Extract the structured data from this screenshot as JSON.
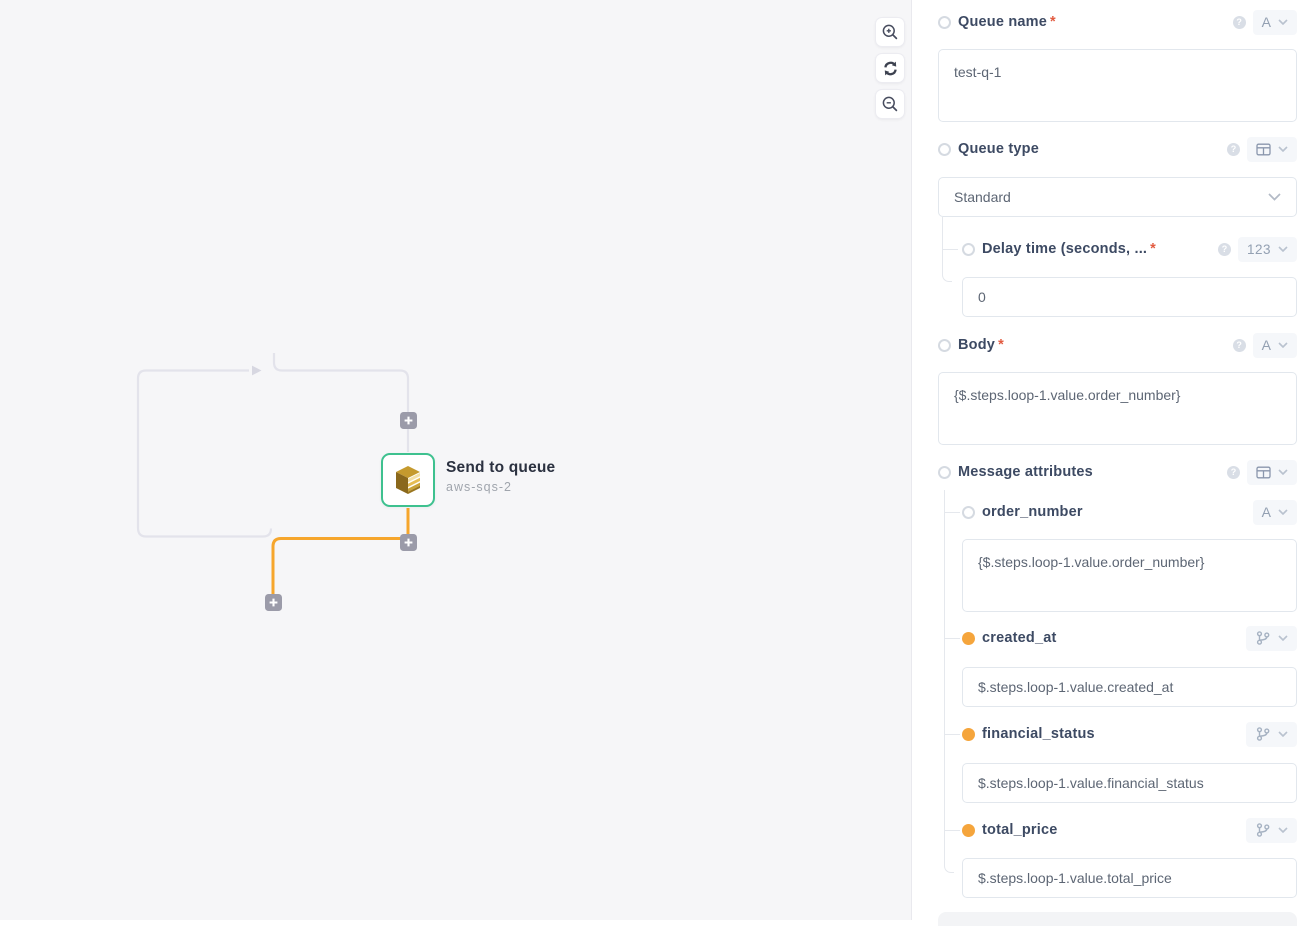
{
  "canvas": {
    "node": {
      "title": "Send to queue",
      "subtitle": "aws-sqs-2"
    },
    "controls": [
      {
        "name": "zoom-in"
      },
      {
        "name": "refresh"
      },
      {
        "name": "zoom-out"
      }
    ]
  },
  "panel": {
    "fields": {
      "queue_name": {
        "label": "Queue name",
        "required_mark": "*",
        "type_badge": "A",
        "value": "test-q-1"
      },
      "queue_type": {
        "label": "Queue type",
        "selected_option": "Standard"
      },
      "delay_time": {
        "label": "Delay time (seconds, ...",
        "required_mark": "*",
        "type_badge": "123",
        "value": "0"
      },
      "body": {
        "label": "Body",
        "required_mark": "*",
        "type_badge": "A",
        "value": "{$.steps.loop-1.value.order_number}"
      },
      "message_attributes": {
        "label": "Message attributes"
      },
      "order_number": {
        "label": "order_number",
        "type_badge": "A",
        "value": "{$.steps.loop-1.value.order_number}"
      },
      "created_at": {
        "label": "created_at",
        "value": "$.steps.loop-1.value.created_at"
      },
      "financial_status": {
        "label": "financial_status",
        "value": "$.steps.loop-1.value.financial_status"
      },
      "total_price": {
        "label": "total_price",
        "value": "$.steps.loop-1.value.total_price"
      }
    }
  },
  "icons": {
    "help_glyph": "?",
    "names": [
      "zoom-in-icon",
      "refresh-icon",
      "zoom-out-icon",
      "plus-icon",
      "aws-sqs-icon",
      "table-icon",
      "branch-icon",
      "chevron-down-icon",
      "help-icon"
    ]
  },
  "colors": {
    "node_border_green": "#3ec18f",
    "edge_orange": "#f6a62c",
    "mapped_dot_orange": "#f5a53c",
    "required_red": "#e25b40",
    "edge_gray": "#e3e3eb",
    "canvas_bg": "#f6f6f8"
  }
}
